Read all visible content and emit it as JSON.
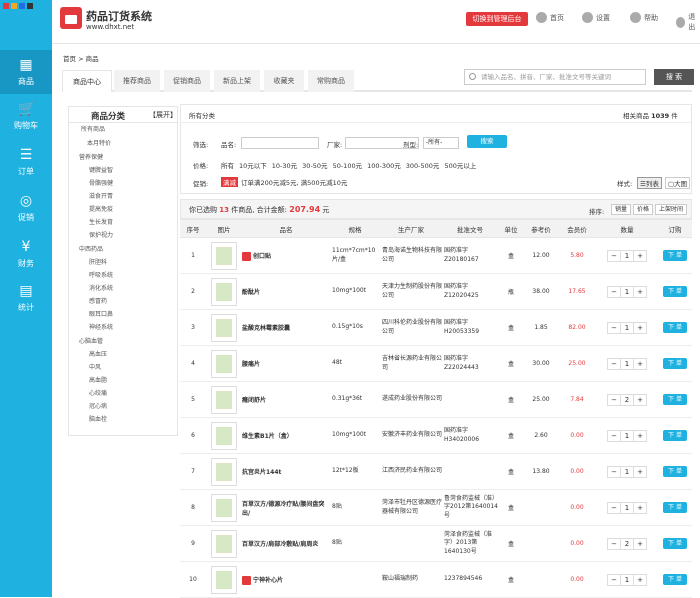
{
  "sidebar": {
    "items": [
      {
        "label": "商品",
        "icon": "grid-icon"
      },
      {
        "label": "购物车",
        "icon": "cart-icon"
      },
      {
        "label": "订单",
        "icon": "order-icon"
      },
      {
        "label": "促销",
        "icon": "promotion-icon"
      },
      {
        "label": "财务",
        "icon": "money-bag-icon"
      },
      {
        "label": "统计",
        "icon": "chart-icon"
      }
    ]
  },
  "header": {
    "logo_title": "药品订货系统",
    "logo_url": "www.dhxt.net",
    "switch_button": "切换到管理后台",
    "nav": {
      "home": "首页",
      "settings": "设置",
      "help": "帮助",
      "exit": "退出"
    }
  },
  "breadcrumb": "首页 > 商品",
  "tabs": [
    "商品中心",
    "推荐商品",
    "促销商品",
    "新品上架",
    "收藏夹",
    "常购商品"
  ],
  "search": {
    "placeholder": "请输入品名、拼音、厂家、批准文号等关键词",
    "button": "搜 索"
  },
  "category": {
    "title": "商品分类",
    "toggle": "【展开】",
    "items": [
      "所有商品",
      "本月特价",
      "营养保健",
      "键脾益智",
      "骨骼强健",
      "滋食开胃",
      "提高免疫",
      "生长发育",
      "保护视力",
      "中西药品",
      "肝胆科",
      "呼吸系统",
      "消化系统",
      "感冒药",
      "眼耳口鼻",
      "神经系统",
      "心脑血管",
      "高血压",
      "中风",
      "高血脂",
      "心绞痛",
      "冠心病",
      "脑血栓"
    ]
  },
  "filter": {
    "path": "所有分类",
    "related_label": "相关商品",
    "related_count": "1039",
    "related_unit": "件",
    "screen_label": "筛选:",
    "name_label": "品名:",
    "maker_label": "厂家:",
    "dosage_label": "剂型:",
    "dosage_value": "-所有-",
    "search_button": "搜索",
    "price_label": "价格:",
    "price_options": [
      "所有",
      "10元以下",
      "10-30元",
      "30-50元",
      "50-100元",
      "100-300元",
      "300-500元",
      "500元以上"
    ],
    "promo_label": "促销:",
    "promo_tag": "满减",
    "promo_text": "订单满200元减5元, 满500元减10元",
    "style_label": "样式:",
    "style_list": "列表",
    "style_big": "大图"
  },
  "summary": {
    "prefix": "你已选购",
    "count": "13",
    "middle": "件商品, 合计金额:",
    "amount": "207.94",
    "unit": "元",
    "sort_label": "排序:",
    "sort_options": [
      "销量",
      "价格",
      "上架时间"
    ]
  },
  "table": {
    "headers": [
      "序号",
      "图片",
      "品名",
      "规格",
      "生产厂家",
      "批准文号",
      "单位",
      "参考价",
      "会员价",
      "数量",
      "订购"
    ],
    "order_button": "下 单",
    "rows": [
      {
        "no": "1",
        "name": "创口贴",
        "rx": true,
        "spec": "11cm*7cm*10片/盒",
        "maker": "青岛海诺生物科技有限公司",
        "approval": "国药准字Z20180167",
        "unit": "盒",
        "ref": "12.00",
        "member": "5.80",
        "qty": "1"
      },
      {
        "no": "2",
        "name": "酚酞片",
        "rx": false,
        "spec": "10mg*100t",
        "maker": "天津力生制药股份有限公司",
        "approval": "国药准字Z12020425",
        "unit": "瓶",
        "ref": "38.00",
        "member": "17.65",
        "qty": "1"
      },
      {
        "no": "3",
        "name": "盐酸克林霉素胶囊",
        "rx": false,
        "spec": "0.15g*10s",
        "maker": "四川科伦药业股份有限公司",
        "approval": "国药准字H20053359",
        "unit": "盒",
        "ref": "1.85",
        "member": "82.00",
        "qty": "1"
      },
      {
        "no": "4",
        "name": "腰痛片",
        "rx": false,
        "spec": "48t",
        "maker": "吉林省长源药业有限公司",
        "approval": "国药准字Z22024443",
        "unit": "盒",
        "ref": "30.00",
        "member": "25.00",
        "qty": "1"
      },
      {
        "no": "5",
        "name": "癃闭舒片",
        "rx": false,
        "spec": "0.31g*36t",
        "maker": "遂成药业股份有限公司",
        "approval": "",
        "unit": "盒",
        "ref": "25.00",
        "member": "7.84",
        "qty": "2"
      },
      {
        "no": "6",
        "name": "维生素B1片（盒）",
        "rx": false,
        "spec": "10mg*100t",
        "maker": "安徽济丰药业有限公司",
        "approval": "国药准字H34020006",
        "unit": "盒",
        "ref": "2.60",
        "member": "0.00",
        "qty": "1"
      },
      {
        "no": "7",
        "name": "抗宫炎片144t",
        "rx": false,
        "spec": "12t*12板",
        "maker": "江西济民药业有限公司",
        "approval": "",
        "unit": "盒",
        "ref": "13.80",
        "member": "0.00",
        "qty": "1"
      },
      {
        "no": "8",
        "name": "百草汉方/德源冷疗贴/腰间盘突出/",
        "rx": false,
        "spec": "8贴",
        "maker": "菏泽市牡丹区德源医疗器械有限公司",
        "approval": "鲁菏食药监械（准）字2012第1640014号",
        "unit": "盒",
        "ref": "",
        "member": "0.00",
        "qty": "1"
      },
      {
        "no": "9",
        "name": "百草汉方/肩部冷敷贴/肩周炎",
        "rx": false,
        "spec": "8贴",
        "maker": "",
        "approval": "菏泽食药监械（准字）2013第1640130号",
        "unit": "盒",
        "ref": "",
        "member": "0.00",
        "qty": "2"
      },
      {
        "no": "10",
        "name": "宁神补心片",
        "rx": true,
        "spec": "",
        "maker": "鞍山福瑞制药",
        "approval": "1237894546",
        "unit": "盒",
        "ref": "",
        "member": "0.00",
        "qty": "1"
      }
    ]
  },
  "colors": {
    "accent": "#1fb1e0",
    "brand_red": "#e4393c"
  }
}
